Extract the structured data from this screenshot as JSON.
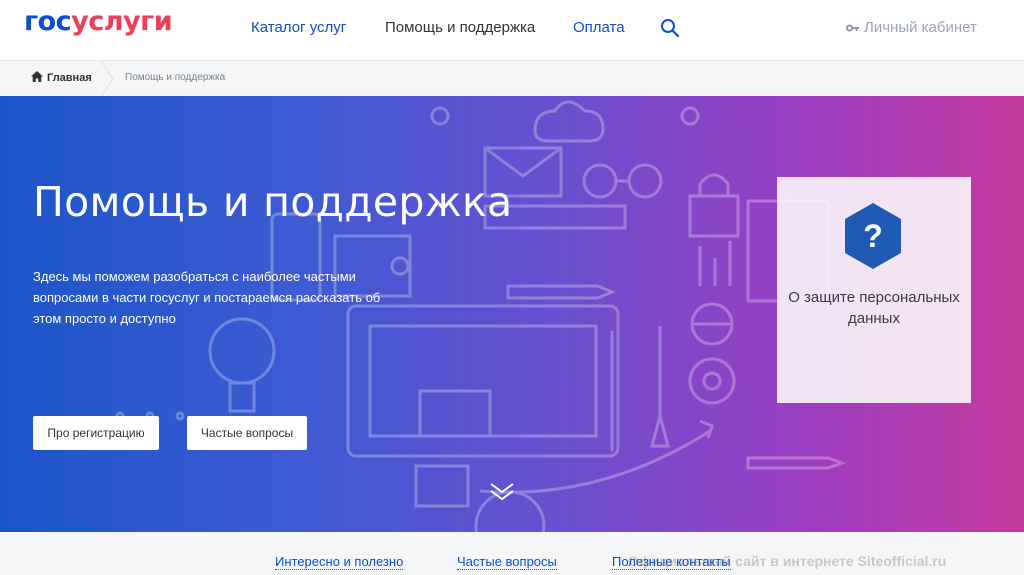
{
  "header": {
    "logo_part1": "гос",
    "logo_part2": "услуги",
    "nav": [
      "Каталог услуг",
      "Помощь и поддержка",
      "Оплата"
    ],
    "cabinet_label": "Личный кабинет",
    "search_icon": "search-icon",
    "cabinet_icon": "key-icon"
  },
  "breadcrumb": {
    "home": "Главная",
    "current": "Помощь и поддержка",
    "home_icon": "home-icon"
  },
  "hero": {
    "title": "Помощь и поддержка",
    "description": "Здесь мы поможем разобраться с наиболее частыми вопросами в части госуслуг и постараемся рассказать об этом просто и доступно",
    "buttons": [
      "Про регистрацию",
      "Частые вопросы"
    ],
    "privacy_card": "О защите персональных данных",
    "privacy_icon": "question-icon"
  },
  "bottom_tabs": [
    "Интересно и полезно",
    "Частые вопросы",
    "Полезные контакты"
  ],
  "watermark": "Официальный сайт в интернете Siteofficial.ru",
  "colors": {
    "brand_blue": "#0d4cd3",
    "brand_red": "#ee3f58",
    "hero_start": "#1b56c8",
    "hero_end": "#c63a9e"
  }
}
